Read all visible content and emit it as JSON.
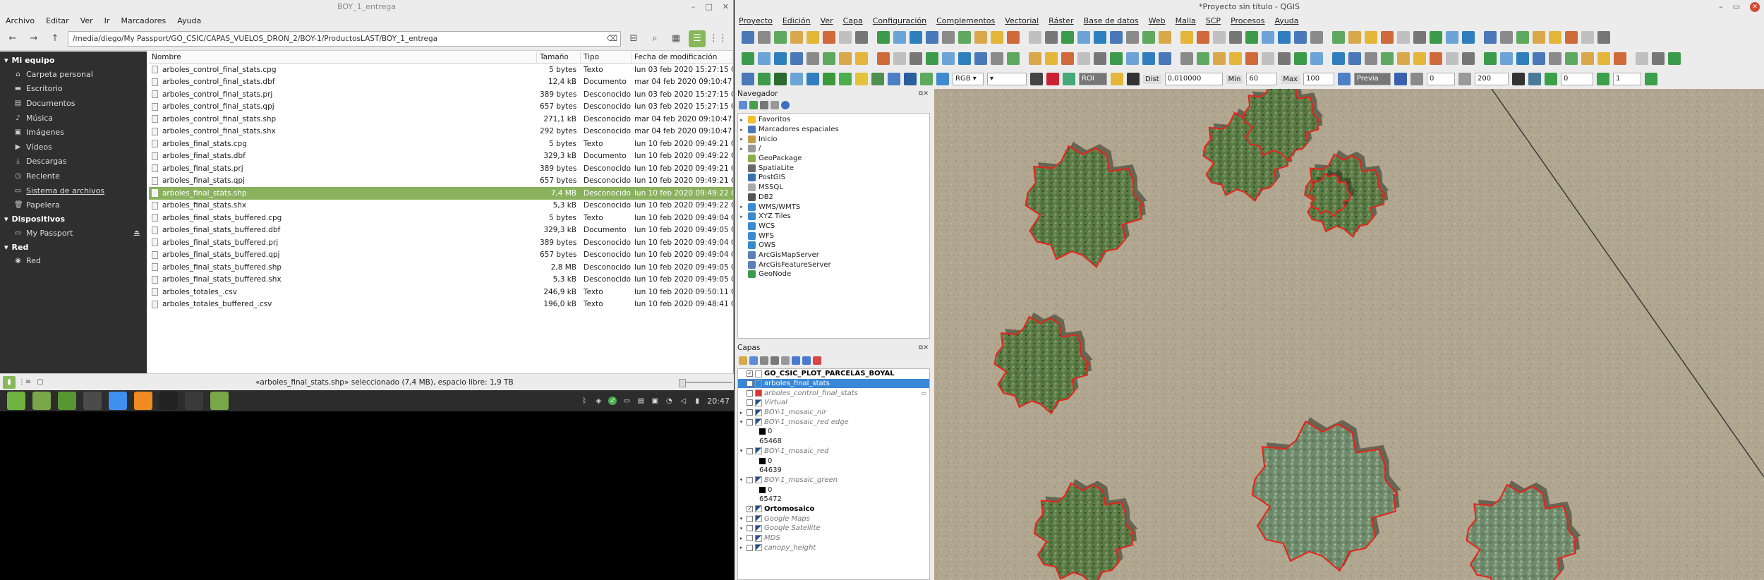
{
  "file_manager": {
    "window_title": "BOY_1_entrega",
    "menu": [
      "Archivo",
      "Editar",
      "Ver",
      "Ir",
      "Marcadores",
      "Ayuda"
    ],
    "path": "/media/diego/My Passport/GO_CSIC/CAPAS_VUELOS_DRON_2/BOY-1/ProductosLAST/BOY_1_entrega",
    "sidebar": {
      "section_my_computer": "Mi equipo",
      "items": [
        "Carpeta personal",
        "Escritorio",
        "Documentos",
        "Música",
        "Imágenes",
        "Vídeos",
        "Descargas",
        "Reciente",
        "Sistema de archivos",
        "Papelera"
      ],
      "section_devices": "Dispositivos",
      "device": "My Passport",
      "section_network": "Red",
      "network_item": "Red"
    },
    "columns": {
      "name": "Nombre",
      "size": "Tamaño",
      "type": "Tipo",
      "date": "Fecha de modificación"
    },
    "files": [
      {
        "name": "arboles_control_final_stats.cpg",
        "size": "5 bytes",
        "type": "Texto",
        "date": "lun 03 feb 2020 15:27:15 CET"
      },
      {
        "name": "arboles_control_final_stats.dbf",
        "size": "12,4 kB",
        "type": "Documento",
        "date": "mar 04 feb 2020 09:10:47 CET"
      },
      {
        "name": "arboles_control_final_stats.prj",
        "size": "389 bytes",
        "type": "Desconocido",
        "date": "lun 03 feb 2020 15:27:15 CET"
      },
      {
        "name": "arboles_control_final_stats.qpj",
        "size": "657 bytes",
        "type": "Desconocido",
        "date": "lun 03 feb 2020 15:27:15 CET"
      },
      {
        "name": "arboles_control_final_stats.shp",
        "size": "271,1 kB",
        "type": "Desconocido",
        "date": "mar 04 feb 2020 09:10:47 CET"
      },
      {
        "name": "arboles_control_final_stats.shx",
        "size": "292 bytes",
        "type": "Desconocido",
        "date": "mar 04 feb 2020 09:10:47 CET"
      },
      {
        "name": "arboles_final_stats.cpg",
        "size": "5 bytes",
        "type": "Texto",
        "date": "lun 10 feb 2020 09:49:21 CET"
      },
      {
        "name": "arboles_final_stats.dbf",
        "size": "329,3 kB",
        "type": "Documento",
        "date": "lun 10 feb 2020 09:49:22 CET"
      },
      {
        "name": "arboles_final_stats.prj",
        "size": "389 bytes",
        "type": "Desconocido",
        "date": "lun 10 feb 2020 09:49:21 CET"
      },
      {
        "name": "arboles_final_stats.qpj",
        "size": "657 bytes",
        "type": "Desconocido",
        "date": "lun 10 feb 2020 09:49:21 CET"
      },
      {
        "name": "arboles_final_stats.shp",
        "size": "7,4 MB",
        "type": "Desconocido",
        "date": "lun 10 feb 2020 09:49:22 CET",
        "selected": true
      },
      {
        "name": "arboles_final_stats.shx",
        "size": "5,3 kB",
        "type": "Desconocido",
        "date": "lun 10 feb 2020 09:49:22 CET"
      },
      {
        "name": "arboles_final_stats_buffered.cpg",
        "size": "5 bytes",
        "type": "Texto",
        "date": "lun 10 feb 2020 09:49:04 CET"
      },
      {
        "name": "arboles_final_stats_buffered.dbf",
        "size": "329,3 kB",
        "type": "Documento",
        "date": "lun 10 feb 2020 09:49:05 CET"
      },
      {
        "name": "arboles_final_stats_buffered.prj",
        "size": "389 bytes",
        "type": "Desconocido",
        "date": "lun 10 feb 2020 09:49:04 CET"
      },
      {
        "name": "arboles_final_stats_buffered.qpj",
        "size": "657 bytes",
        "type": "Desconocido",
        "date": "lun 10 feb 2020 09:49:04 CET"
      },
      {
        "name": "arboles_final_stats_buffered.shp",
        "size": "2,8 MB",
        "type": "Desconocido",
        "date": "lun 10 feb 2020 09:49:05 CET"
      },
      {
        "name": "arboles_final_stats_buffered.shx",
        "size": "5,3 kB",
        "type": "Desconocido",
        "date": "lun 10 feb 2020 09:49:05 CET"
      },
      {
        "name": "arboles_totales_.csv",
        "size": "246,9 kB",
        "type": "Texto",
        "date": "lun 10 feb 2020 09:50:11 CET"
      },
      {
        "name": "arboles_totales_buffered_.csv",
        "size": "196,0 kB",
        "type": "Texto",
        "date": "lun 10 feb 2020 09:48:41 CET"
      }
    ],
    "status": "«arboles_final_stats.shp» seleccionado (7,4 MB), espacio libre: 1,9 TB"
  },
  "taskbar": {
    "apps": [
      {
        "name": "mint-menu-icon",
        "color": "#6fb43f"
      },
      {
        "name": "files-icon",
        "color": "#7aa64a"
      },
      {
        "name": "qgis-icon",
        "color": "#589632"
      },
      {
        "name": "sublime-icon",
        "color": "#4b4b4b"
      },
      {
        "name": "chrome-icon",
        "color": "#3f8ff0"
      },
      {
        "name": "firefox-icon",
        "color": "#f08b22"
      },
      {
        "name": "terminal-icon",
        "color": "#222222"
      },
      {
        "name": "monitor-icon",
        "color": "#3a3a3a"
      },
      {
        "name": "folder-icon",
        "color": "#7aa64a"
      }
    ],
    "clock": "20:47"
  },
  "qgis": {
    "window_title": "*Proyecto sin título - QGIS",
    "menu": [
      "Proyecto",
      "Edición",
      "Ver",
      "Capa",
      "Configuración",
      "Complementos",
      "Vectorial",
      "Ráster",
      "Base de datos",
      "Web",
      "Malla",
      "SCP",
      "Procesos",
      "Ayuda"
    ],
    "toolbar_fields": {
      "band": "RGB",
      "dist_label": "Dist",
      "dist_value": "0,010000",
      "min_label": "Min",
      "min_value": "60",
      "max_label": "Max",
      "max_value": "100",
      "roi": "ROI",
      "preview": "Previa",
      "t_value": "0",
      "size_value": "200",
      "a_value": "0",
      "b_value": "1"
    },
    "navigator": {
      "title": "Navegador",
      "items": [
        "Favoritos",
        "Marcadores espaciales",
        "Inicio",
        "/",
        "GeoPackage",
        "SpatiaLite",
        "PostGIS",
        "MSSQL",
        "DB2",
        "WMS/WMTS",
        "XYZ Tiles",
        "WCS",
        "WFS",
        "OWS",
        "ArcGisMapServer",
        "ArcGisFeatureServer",
        "GeoNode"
      ]
    },
    "layers": {
      "title": "Capas",
      "rows": [
        {
          "label": "GO_CSIC_PLOT_PARCELAS_BOYAL",
          "style": "b",
          "checked": true,
          "arrow": "",
          "icon": "white"
        },
        {
          "label": "arboles_final_stats",
          "style": "sel",
          "checked": true,
          "arrow": "",
          "icon": "line"
        },
        {
          "label": "arboles_control_final_stats",
          "style": "i",
          "checked": false,
          "arrow": "",
          "icon": "red"
        },
        {
          "label": "Virtual",
          "style": "i",
          "checked": false,
          "arrow": "",
          "icon": "raster"
        },
        {
          "label": "BOY-1_mosaic_nir",
          "style": "i",
          "checked": false,
          "arrow": "▸",
          "icon": "raster"
        },
        {
          "label": "BOY-1_mosaic_red edge",
          "style": "i",
          "checked": false,
          "arrow": "▾",
          "icon": "raster"
        },
        {
          "label": "0",
          "style": "legend",
          "swatch": true
        },
        {
          "label": "65468",
          "style": "legend"
        },
        {
          "label": "BOY-1_mosaic_red",
          "style": "i",
          "checked": false,
          "arrow": "▾",
          "icon": "raster"
        },
        {
          "label": "0",
          "style": "legend",
          "swatch": true
        },
        {
          "label": "64639",
          "style": "legend"
        },
        {
          "label": "BOY-1_mosaic_green",
          "style": "i",
          "checked": false,
          "arrow": "▾",
          "icon": "raster"
        },
        {
          "label": "0",
          "style": "legend",
          "swatch": true
        },
        {
          "label": "65472",
          "style": "legend"
        },
        {
          "label": "Ortomosaico",
          "style": "b",
          "checked": true,
          "arrow": "",
          "icon": "raster"
        },
        {
          "label": "Google Maps",
          "style": "i",
          "checked": false,
          "arrow": "▾",
          "icon": "raster"
        },
        {
          "label": "Google Satellite",
          "style": "i",
          "checked": false,
          "arrow": "▾",
          "icon": "raster"
        },
        {
          "label": "MDS",
          "style": "i",
          "checked": false,
          "arrow": "▸",
          "icon": "raster"
        },
        {
          "label": "canopy_height",
          "style": "i",
          "checked": false,
          "arrow": "▸",
          "icon": "raster"
        }
      ]
    }
  }
}
